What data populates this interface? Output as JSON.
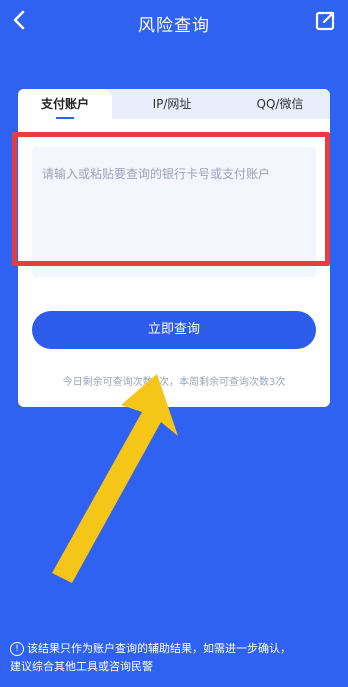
{
  "header": {
    "title": "风险查询",
    "back_icon": "chevron-left-icon",
    "share_icon": "share-external-icon"
  },
  "tabs": [
    {
      "label": "支付账户"
    },
    {
      "label": "IP/网址"
    },
    {
      "label": "QQ/微信"
    }
  ],
  "search": {
    "placeholder": "请输入或粘贴要查询的银行卡号或支付账户"
  },
  "query_button": "立即查询",
  "quota_note": "今日剩余可查询次数1次，本周剩余可查询次数3次",
  "footer": {
    "info_icon": "info-circle-icon",
    "info_glyph": "!",
    "line1": "该结果只作为账户查询的辅助结果，如需进一步确认，",
    "line2": "建议综合其他工具或咨询民警"
  },
  "colors": {
    "background": "#2f62f0",
    "highlight": "#e63d43",
    "arrow": "#f5c518",
    "button": "#2d5bea"
  }
}
